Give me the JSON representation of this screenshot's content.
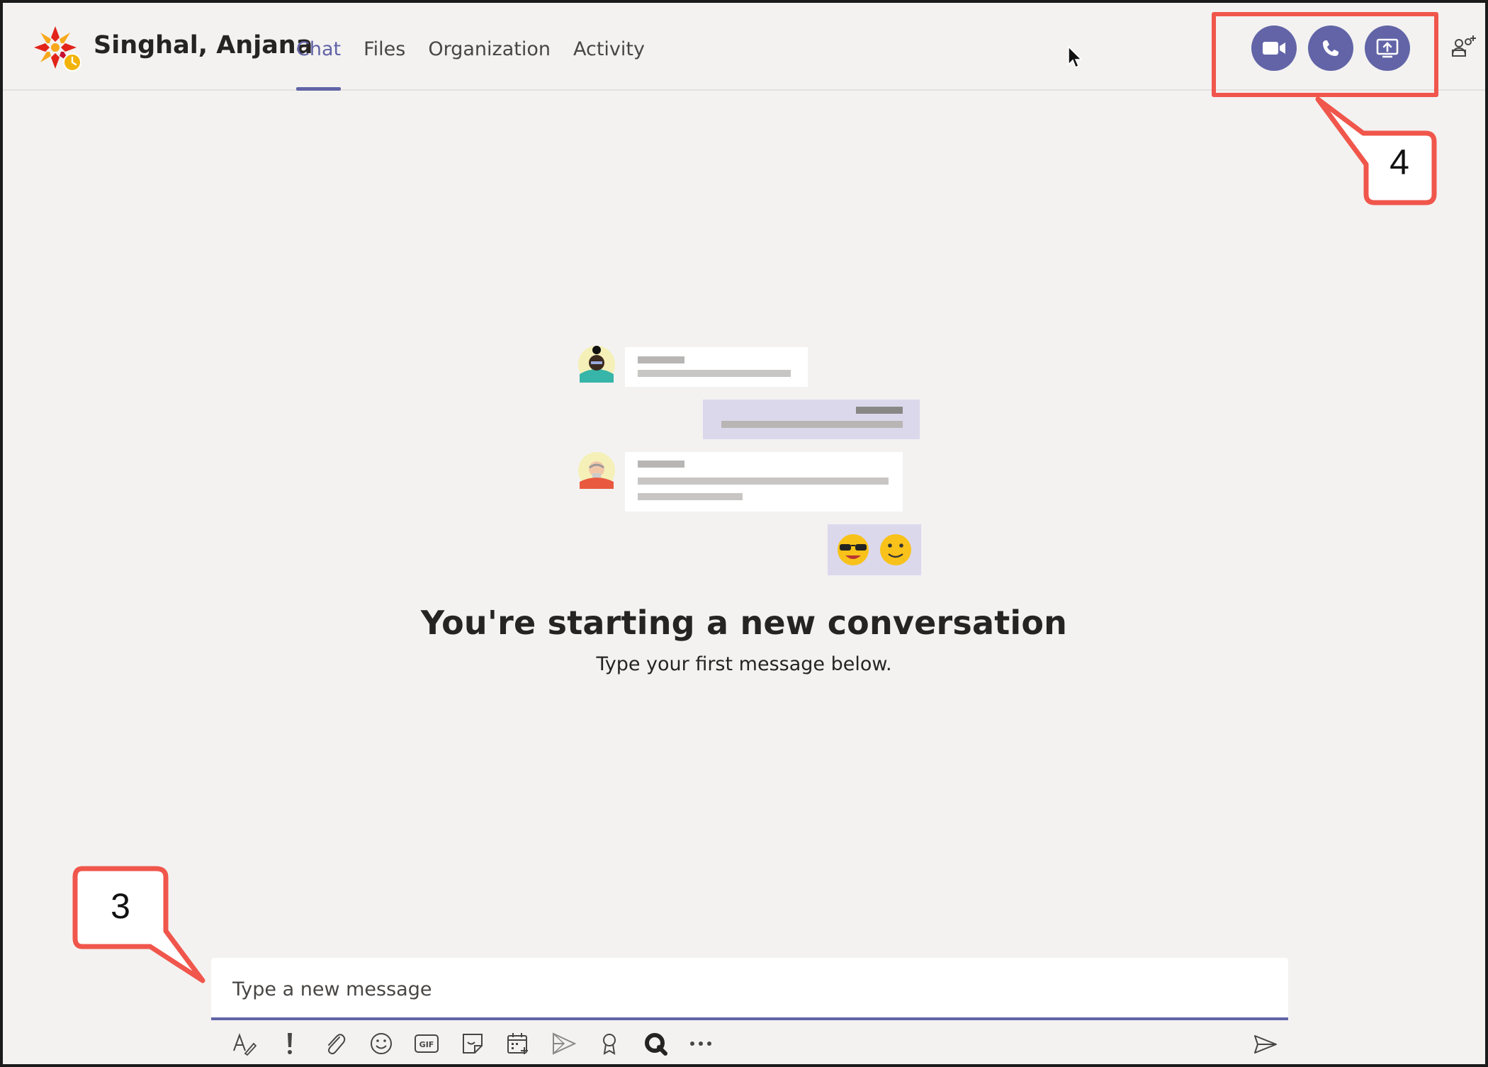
{
  "header": {
    "chat_title": "Singhal, Anjana",
    "tabs": [
      {
        "label": "Chat",
        "active": true
      },
      {
        "label": "Files",
        "active": false
      },
      {
        "label": "Organization",
        "active": false
      },
      {
        "label": "Activity",
        "active": false
      }
    ],
    "actions": [
      {
        "name": "video-call",
        "icon": "video-camera-icon"
      },
      {
        "name": "audio-call",
        "icon": "phone-icon"
      },
      {
        "name": "screen-share",
        "icon": "share-screen-icon"
      }
    ],
    "add_people_icon": "add-people-icon"
  },
  "annotations": {
    "callout_top": "4",
    "callout_bottom": "3",
    "color": "#f0564b"
  },
  "empty_state": {
    "title": "You're starting a new conversation",
    "subtitle": "Type your first message below."
  },
  "compose": {
    "placeholder": "Type a new message"
  },
  "toolbar": [
    {
      "name": "format",
      "icon": "format-icon"
    },
    {
      "name": "important",
      "icon": "exclamation-icon"
    },
    {
      "name": "attach",
      "icon": "paperclip-icon"
    },
    {
      "name": "emoji",
      "icon": "emoji-icon"
    },
    {
      "name": "gif",
      "icon": "gif-icon"
    },
    {
      "name": "sticker",
      "icon": "sticker-icon"
    },
    {
      "name": "schedule-meeting",
      "icon": "calendar-icon"
    },
    {
      "name": "stream",
      "icon": "stream-icon"
    },
    {
      "name": "praise",
      "icon": "praise-icon"
    },
    {
      "name": "app",
      "icon": "app-q-icon"
    },
    {
      "name": "more",
      "icon": "more-icon"
    }
  ],
  "send_icon": "send-icon",
  "colors": {
    "accent": "#6264a7",
    "background": "#f3f2f1",
    "text": "#252423",
    "annotation": "#f0564b"
  }
}
